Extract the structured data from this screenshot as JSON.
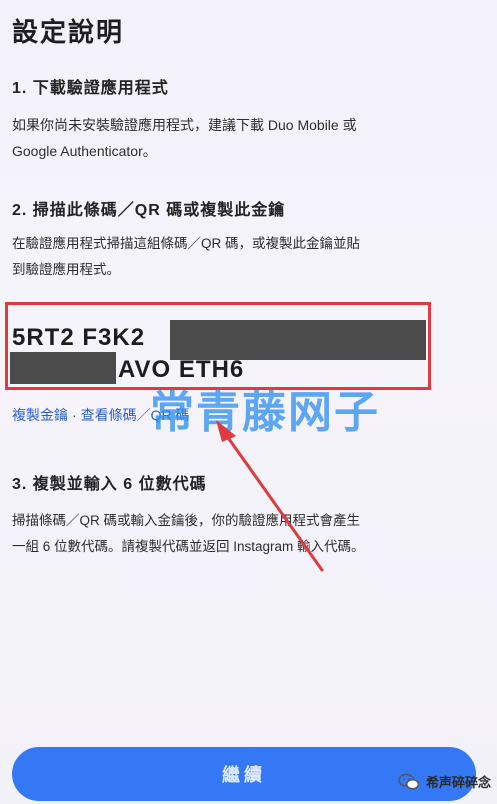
{
  "page": {
    "title": "設定說明"
  },
  "step1": {
    "title": "1. 下載驗證應用程式",
    "desc_line1": "如果你尚未安裝驗證應用程式，建議下載 Duo Mobile 或",
    "desc_line2": "Google Authenticator。"
  },
  "step2": {
    "title": "2. 掃描此條碼／QR 碼或複製此金鑰",
    "desc_line1": "在驗證應用程式掃描這組條碼／QR 碼，或複製此金鑰並貼",
    "desc_line2": "到驗證應用程式。"
  },
  "key": {
    "part1": "5RT2 F3K2",
    "part2": "AVO ETH6"
  },
  "links": {
    "copy_key": "複製金鑰",
    "view_code": "查看條碼／QR 碼",
    "separator": "·"
  },
  "step3": {
    "title": "3. 複製並輸入 6 位數代碼",
    "desc_line1": "掃描條碼／QR 碼或輸入金鑰後，你的驗證應用程式會產生",
    "desc_line2": "一組 6 位數代碼。請複製代碼並返回 Instagram 輸入代碼。"
  },
  "watermark": "常青藤网子",
  "continue_button": {
    "label": "繼續"
  },
  "brand": {
    "name": "希声碎碎念",
    "icon": "wechat-icon"
  },
  "colors": {
    "accent": "#3478f6",
    "highlight_border": "#e03a41",
    "link": "#2a5fd0",
    "arrow": "#e03a41"
  }
}
